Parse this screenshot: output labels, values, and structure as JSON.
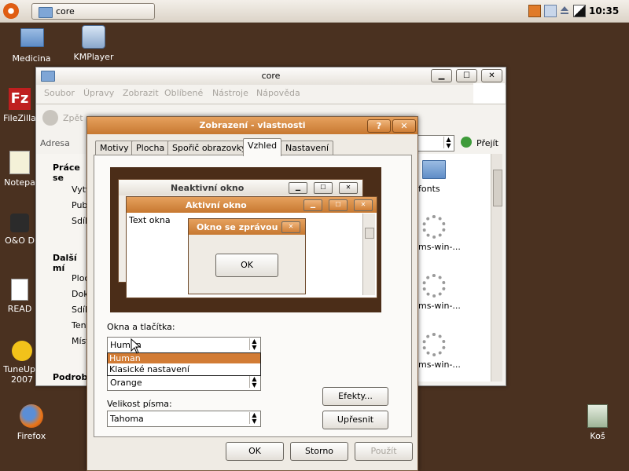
{
  "top_panel": {
    "taskbar_item": "core",
    "clock": "10:35"
  },
  "desktop_icons": {
    "medicina": "Medicina",
    "kmplayer": "KMPlayer",
    "filezilla": "FileZilla",
    "notepad": "Notepa",
    "oo": "O&O D",
    "readme": "READ",
    "tuneup": "TuneUp I",
    "tuneup_year": "2007",
    "firefox": "Firefox",
    "trash": "Koš"
  },
  "explorer": {
    "title": "core",
    "menu": [
      "Soubor",
      "Úpravy",
      "Zobrazit",
      "Oblíbené",
      "Nástroje",
      "Nápověda"
    ],
    "back_label": "Zpět",
    "address_label": "Adresa",
    "go_label": "Přejít",
    "sidebar_section1": "Práce se",
    "sidebar_items1": [
      "Vytv",
      "Publ",
      "Sdíle"
    ],
    "sidebar_section2": "Další mí",
    "sidebar_items2": [
      "Ploch",
      "Doku",
      "Sdíle",
      "Tent",
      "Míst"
    ],
    "sidebar_section3": "Podrobn",
    "files": [
      "fonts",
      "ms-win-...",
      "ms-win-...",
      "ms-win-..."
    ]
  },
  "dialog": {
    "title": "Zobrazení - vlastnosti",
    "help_btn": "?",
    "close_btn": "✕",
    "tabs": [
      "Motivy",
      "Plocha",
      "Spořič obrazovky",
      "Vzhled",
      "Nastavení"
    ],
    "preview": {
      "inactive_title": "Neaktivní okno",
      "active_title": "Aktivní okno",
      "window_text": "Text okna",
      "msgbox_title": "Okno se zprávou",
      "ok": "OK"
    },
    "windows_buttons_label": "Okna a tlačítka:",
    "windows_buttons_value": "Human",
    "dropdown_options": [
      "Human",
      "Klasické nastavení"
    ],
    "dropdown_selected_index": 0,
    "color_scheme_value": "Orange",
    "font_size_label": "Velikost písma:",
    "font_size_value": "Tahoma",
    "effects_btn": "Efekty...",
    "advanced_btn": "Upřesnit",
    "ok_btn": "OK",
    "cancel_btn": "Storno",
    "apply_btn": "Použít"
  },
  "colors": {
    "accent_orange": "#c77830",
    "desktop_brown": "#4a3120",
    "selection": "#d27c35"
  }
}
